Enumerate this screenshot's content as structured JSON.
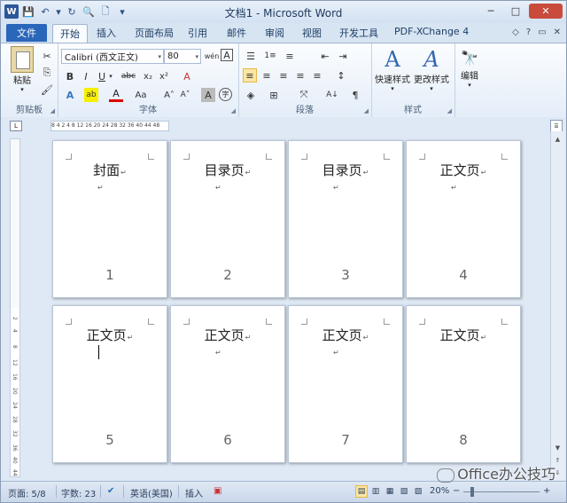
{
  "window": {
    "title": "文档1 - Microsoft Word",
    "app_icon": "W",
    "controls": {
      "minimize": "─",
      "maximize": "□",
      "close": "✕"
    }
  },
  "qat": {
    "save": "💾",
    "undo": "↶",
    "undo_dd": "▾",
    "repeat": "↻",
    "print_preview": "🔍",
    "new": "🗋",
    "customize": "▾"
  },
  "tabs": {
    "file": "文件",
    "items": [
      "开始",
      "插入",
      "页面布局",
      "引用",
      "邮件",
      "审阅",
      "视图",
      "开发工具",
      "PDF-XChange 4"
    ],
    "active_index": 0,
    "right_icons": [
      "◇",
      "?",
      "▭",
      "✕"
    ]
  },
  "ribbon": {
    "clipboard": {
      "label": "剪贴板",
      "paste": "粘贴",
      "paste_dd": "▾",
      "cut": "✂",
      "copy": "⎘",
      "format_painter": "🖌"
    },
    "font": {
      "label": "字体",
      "font_name": "Calibri (西文正文)",
      "font_size": "80",
      "wen": "wén",
      "char_border": "A",
      "bold": "B",
      "italic": "I",
      "underline": "U",
      "underline_dd": "▾",
      "strike": "abc",
      "subscript": "x₂",
      "superscript": "x²",
      "clear": "A",
      "text_effect": "A",
      "highlight": "ab",
      "font_color": "A",
      "case": "Aa",
      "grow": "A˄",
      "shrink": "A˅",
      "char_shading": "A",
      "enclose": "字"
    },
    "paragraph": {
      "label": "段落",
      "bullets": "☰",
      "numbering": "1≡",
      "multilevel": "≡",
      "dec_indent": "⇤",
      "inc_indent": "⇥",
      "align_left": "≡",
      "center": "≡",
      "align_right": "≡",
      "justify": "≡",
      "distributed": "≡",
      "line_spacing": "↕",
      "shading": "◈",
      "borders": "⊞",
      "chinese_layout": "⤧",
      "sort": "A↓",
      "show_marks": "¶"
    },
    "styles": {
      "label": "样式",
      "quick": "快速样式",
      "change": "更改样式",
      "big_a": "A"
    },
    "editing": {
      "label": "编辑",
      "icon": "🔭"
    }
  },
  "ruler": {
    "tab_selector": "L",
    "marks": "8 4 2 4 8 12 16 20 24 28 32 36 40 44 48",
    "v_ticks": [
      "2",
      "4",
      "8",
      "12",
      "16",
      "20",
      "24",
      "28",
      "32",
      "36",
      "40",
      "44"
    ],
    "toggle": "⌸"
  },
  "pages": [
    {
      "heading": "封面",
      "number": "1"
    },
    {
      "heading": "目录页",
      "number": "2"
    },
    {
      "heading": "目录页",
      "number": "3"
    },
    {
      "heading": "正文页",
      "number": "4"
    },
    {
      "heading": "正文页",
      "number": "5"
    },
    {
      "heading": "正文页",
      "number": "6"
    },
    {
      "heading": "正文页",
      "number": "7"
    },
    {
      "heading": "正文页",
      "number": "8"
    }
  ],
  "para_mark": "↵",
  "statusbar": {
    "page": "页面: 5/8",
    "words": "字数: 23",
    "proof": "✔",
    "language": "英语(美国)",
    "mode": "插入",
    "macro": "▣",
    "zoom": "20%",
    "zoom_minus": "−",
    "zoom_plus": "+",
    "views": [
      "▤",
      "▥",
      "▦",
      "▧",
      "▨"
    ]
  },
  "watermark": "Office办公技巧"
}
